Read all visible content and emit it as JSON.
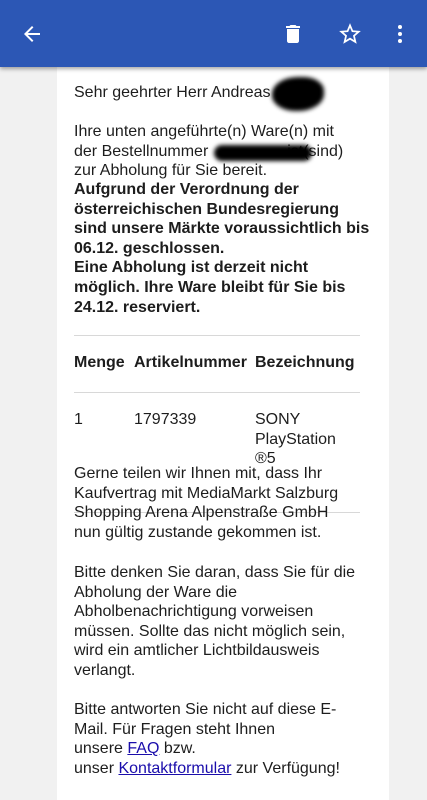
{
  "appbar": {
    "back_icon": "arrow-left-icon",
    "delete_icon": "trash-icon",
    "star_icon": "star-outline-icon",
    "more_icon": "more-vertical-icon",
    "color": "#2c57b5"
  },
  "email": {
    "greeting": "Sehr geehrter Herr Andreas",
    "intro_lines": [
      "Ihre unten angeführte(n) Ware(n) mit",
      "der Bestellnummer",
      "ist(sind)",
      "zur Abholung für Sie bereit."
    ],
    "notice_lines": [
      "Aufgrund der Verordnung der",
      "österreichischen Bundesregierung",
      "sind unsere Märkte voraussichtlich bis",
      "06.12. geschlossen.",
      "Eine Abholung ist derzeit nicht",
      "möglich. Ihre Ware bleibt für Sie bis",
      "24.12. reserviert."
    ],
    "table": {
      "headers": [
        "Menge",
        "Artikelnummer",
        "Bezeichnung"
      ],
      "row": {
        "menge": "1",
        "artikelnummer": "1797339",
        "bezeichnung_lines": [
          "SONY",
          "PlayStation",
          "®5"
        ]
      }
    },
    "contract_lines": [
      "Gerne teilen wir Ihnen mit, dass Ihr",
      "Kaufvertrag mit MediaMarkt Salzburg",
      "Shopping Arena Alpenstraße GmbH",
      "nun gültig zustande gekommen ist."
    ],
    "pickup_lines": [
      "Bitte denken Sie daran, dass Sie für die",
      "Abholung der Ware die",
      "Abholbenachrichtigung vorweisen",
      "müssen. Sollte das nicht möglich sein,",
      "wird ein amtlicher Lichtbildausweis",
      "verlangt."
    ],
    "reply": {
      "line1": "Bitte antworten Sie nicht auf diese E-",
      "line2": "Mail. Für Fragen steht Ihnen",
      "line3_prefix": "unsere",
      "faq_link": "FAQ",
      "line3_suffix": "bzw.",
      "line4_prefix": "unser",
      "contact_link": "Kontaktformular",
      "line4_suffix": "zur Verfügung!"
    }
  }
}
